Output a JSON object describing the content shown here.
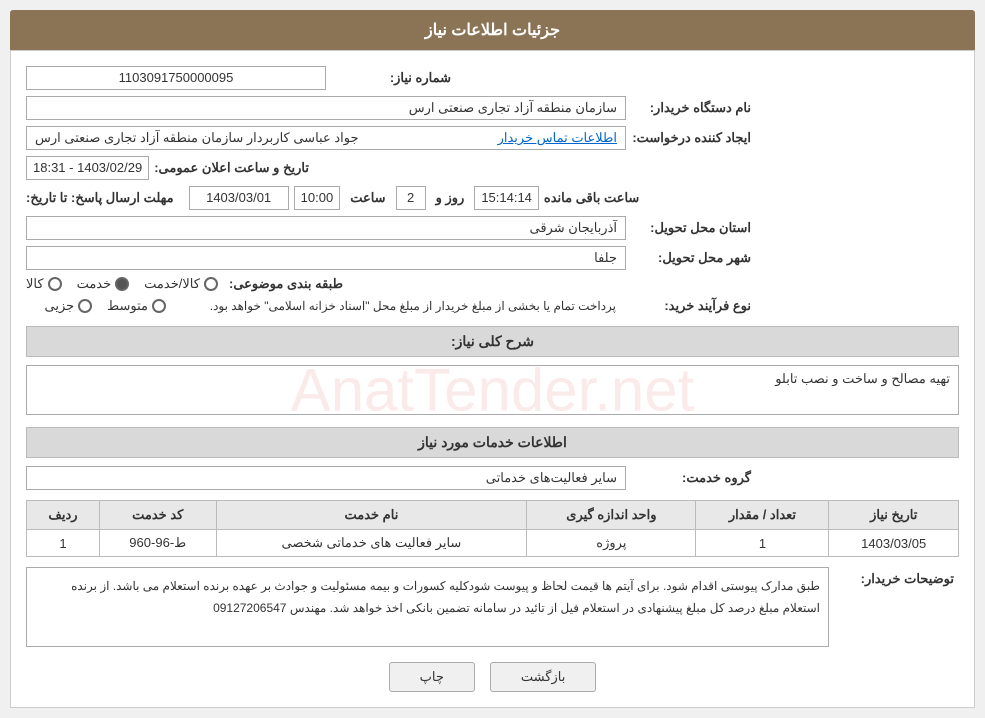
{
  "header": {
    "title": "جزئیات اطلاعات نیاز"
  },
  "fields": {
    "need_number_label": "شماره نیاز:",
    "need_number_value": "1103091750000095",
    "buyer_org_label": "نام دستگاه خریدار:",
    "buyer_org_value": "سازمان منطقه آزاد تجاری صنعتی ارس",
    "creator_label": "ایجاد کننده درخواست:",
    "creator_value": "جواد عباسی کاربردار سازمان منطقه آزاد تجاری صنعتی ارس",
    "contact_link": "اطلاعات تماس خریدار",
    "date_label": "تاریخ و ساعت اعلان عمومی:",
    "date_value": "1403/02/29 - 18:31",
    "reply_date_label": "مهلت ارسال پاسخ: تا تاریخ:",
    "reply_date_value": "1403/03/01",
    "reply_time_label": "ساعت",
    "reply_time_value": "10:00",
    "reply_days_label": "روز و",
    "reply_days_value": "2",
    "remaining_label": "ساعت باقی مانده",
    "remaining_value": "15:14:14",
    "province_label": "استان محل تحویل:",
    "province_value": "آذربایجان شرقی",
    "city_label": "شهر محل تحویل:",
    "city_value": "جلفا",
    "category_label": "طبقه بندی موضوعی:",
    "category_options": [
      "کالا",
      "خدمت",
      "کالا/خدمت"
    ],
    "category_selected": "خدمت",
    "purchase_label": "نوع فرآیند خرید:",
    "purchase_options": [
      "جزیی",
      "متوسط"
    ],
    "purchase_text": "پرداخت تمام یا بخشی از مبلغ خریدار از مبلغ محل \"اسناد خزانه اسلامی\" خواهد بود.",
    "description_label": "شرح کلی نیاز:",
    "description_value": "تهیه مصالح و ساخت و نصب تابلو",
    "services_section": "اطلاعات خدمات مورد نیاز",
    "service_group_label": "گروه خدمت:",
    "service_group_value": "سایر فعالیت‌های خدماتی",
    "table": {
      "headers": [
        "ردیف",
        "کد خدمت",
        "نام خدمت",
        "واحد اندازه گیری",
        "تعداد / مقدار",
        "تاریخ نیاز"
      ],
      "rows": [
        {
          "row": "1",
          "code": "ط-96-960",
          "service": "سایر فعالیت های خدماتی شخصی",
          "unit": "پروژه",
          "quantity": "1",
          "date": "1403/03/05"
        }
      ]
    },
    "buyer_notes_label": "توضیحات خریدار:",
    "buyer_notes_value": "طبق مدارک پیوستی اقدام شود. برای آیتم ها قیمت لحاظ و پیوست شودکلیه کسورات و بیمه مسئولیت و جوادث بر عهده برنده استعلام می باشد. از برنده استعلام مبلغ درصد کل مبلغ پیشنهادی در استعلام فیل از تائید در سامانه تضمین بانکی اخذ خواهد شد. مهندس 09127206547"
  },
  "buttons": {
    "back": "بازگشت",
    "print": "چاپ"
  }
}
